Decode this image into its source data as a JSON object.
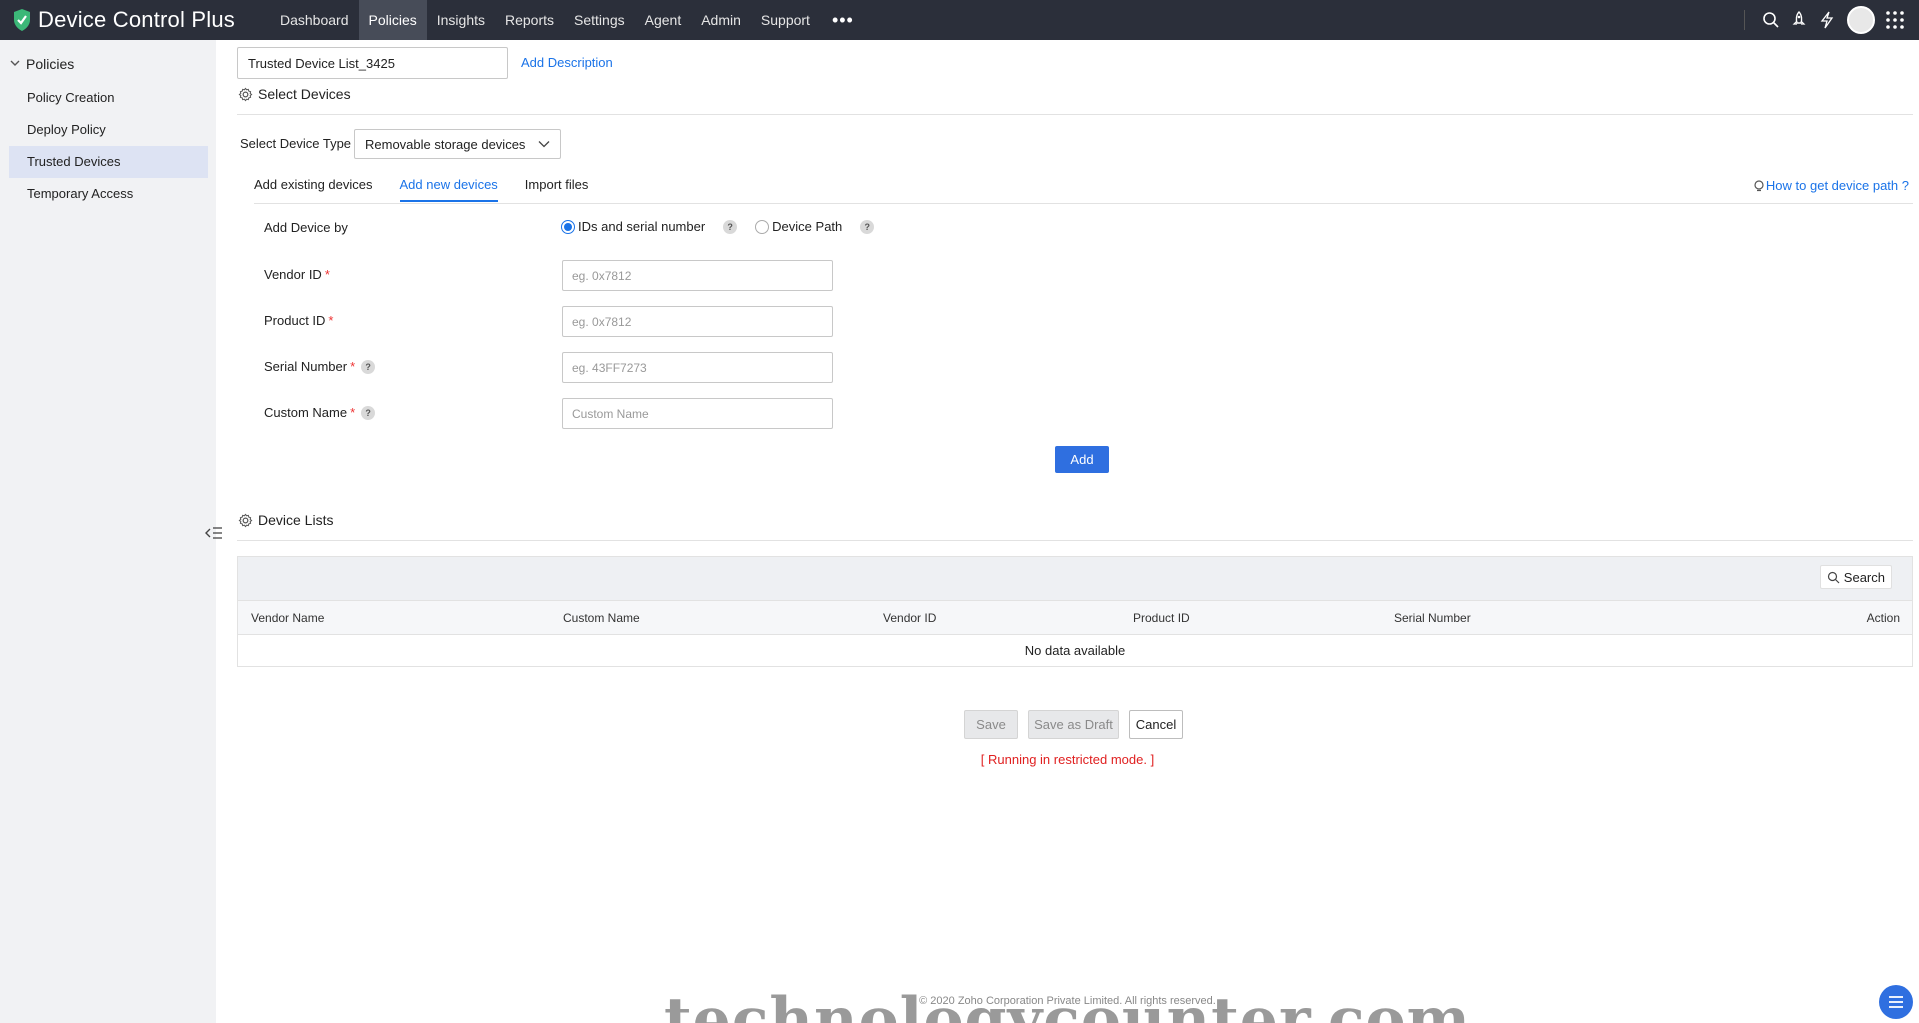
{
  "app": {
    "name": "Device Control Plus"
  },
  "nav": [
    "Dashboard",
    "Policies",
    "Insights",
    "Reports",
    "Settings",
    "Agent",
    "Admin",
    "Support"
  ],
  "nav_more": "•••",
  "sidebar": {
    "section": "Policies",
    "items": [
      "Policy Creation",
      "Deploy Policy",
      "Trusted Devices",
      "Temporary Access"
    ]
  },
  "policy": {
    "name_value": "Trusted Device List_3425",
    "add_description": "Add Description"
  },
  "select_devices": {
    "title": "Select Devices",
    "device_type_label": "Select Device Type",
    "device_type_value": "Removable storage devices"
  },
  "tabs": [
    "Add existing devices",
    "Add new devices",
    "Import files"
  ],
  "howto_link": "How to get device path ?",
  "form": {
    "add_by_label": "Add Device by",
    "radio_ids": "IDs and serial number",
    "radio_path": "Device Path",
    "vendor_id_label": "Vendor ID",
    "vendor_id_placeholder": "eg. 0x7812",
    "product_id_label": "Product ID",
    "product_id_placeholder": "eg. 0x7812",
    "serial_label": "Serial Number",
    "serial_placeholder": "eg. 43FF7273",
    "custom_name_label": "Custom Name",
    "custom_name_placeholder": "Custom Name",
    "required_mark": "*",
    "help_mark": "?",
    "add_button": "Add"
  },
  "device_lists": {
    "title": "Device Lists",
    "search": "Search",
    "columns": [
      "Vendor Name",
      "Custom Name",
      "Vendor ID",
      "Product ID",
      "Serial Number",
      "Action"
    ],
    "empty": "No data available"
  },
  "actions": {
    "save": "Save",
    "save_draft": "Save as Draft",
    "cancel": "Cancel",
    "restricted": "[ Running in restricted mode. ]"
  },
  "footer": "© 2020 Zoho Corporation Private Limited. All rights reserved.",
  "watermark": "technologycounter.com",
  "colors": {
    "accent": "#2f6fe0",
    "topbar": "#2b2f3a",
    "link": "#1a73e8",
    "error": "#e02020"
  }
}
